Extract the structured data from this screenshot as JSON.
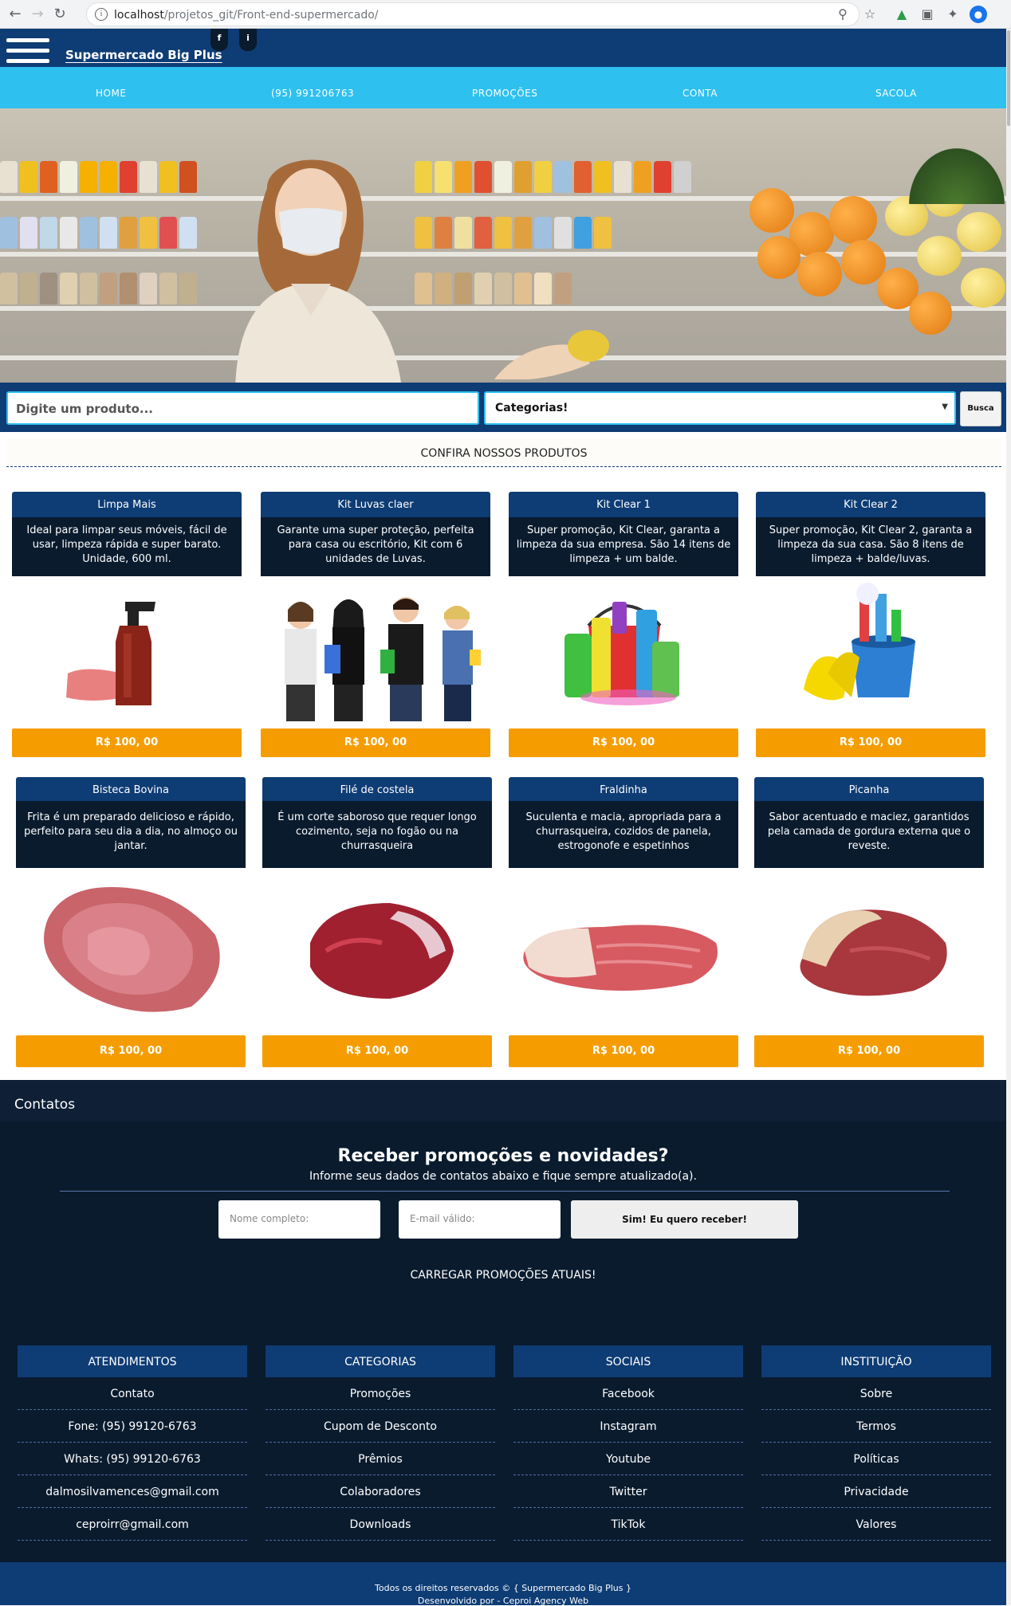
{
  "browser": {
    "url_host": "localhost",
    "url_path": "/projetos_git/Front-end-supermercado/"
  },
  "header": {
    "site_name": "Supermercado Big Plus",
    "social_f": "f",
    "social_i": "i"
  },
  "nav": {
    "items": [
      "HOME",
      "(95) 991206763",
      "PROMOÇÕES",
      "CONTA",
      "SACOLA"
    ]
  },
  "search": {
    "placeholder": "Digite um produto...",
    "category_selected": "Categorias!",
    "button_label": "Busca"
  },
  "products_section": {
    "title": "CONFIRA NOSSOS PRODUTOS"
  },
  "products": [
    {
      "name": "Limpa Mais",
      "description": "Ideal para limpar seus móveis, fácil de usar, limpeza rápida e super barato. Unidade, 600 ml.",
      "price": "R$ 100, 00",
      "image_icon": "spray-bottle-icon"
    },
    {
      "name": "Kit Luvas claer",
      "description": "Garante uma super proteção, perfeita para casa ou escritório, Kit com 6 unidades de Luvas.",
      "price": "R$ 100, 00",
      "image_icon": "cleaning-team-icon"
    },
    {
      "name": "Kit Clear 1",
      "description": "Super promoção, Kit Clear, garanta a limpeza da sua empresa. São 14 itens de limpeza + um balde.",
      "price": "R$ 100, 00",
      "image_icon": "cleaning-bucket-icon"
    },
    {
      "name": "Kit Clear 2",
      "description": "Super promoção, Kit Clear 2, garanta a limpeza da sua casa. São 8 itens de limpeza + balde/luvas.",
      "price": "R$ 100, 00",
      "image_icon": "bucket-gloves-icon"
    },
    {
      "name": "Bisteca Bovina",
      "description": "Frita é um preparado delicioso e rápido, perfeito para seu dia a dia, no almoço ou jantar.",
      "price": "R$ 100, 00",
      "image_icon": "steak-icon"
    },
    {
      "name": "Filé de costela",
      "description": "É um corte saboroso que requer longo cozimento, seja no fogão ou na churrasqueira",
      "price": "R$ 100, 00",
      "image_icon": "rib-meat-icon"
    },
    {
      "name": "Fraldinha",
      "description": "Suculenta e macia, apropriada para a churrasqueira, cozidos de panela, estrogonofe e espetinhos",
      "price": "R$ 100, 00",
      "image_icon": "flank-meat-icon"
    },
    {
      "name": "Picanha",
      "description": "Sabor acentuado e maciez, garantidos pela camada de gordura externa que o reveste.",
      "price": "R$ 100, 00",
      "image_icon": "picanha-icon"
    }
  ],
  "contacts": {
    "title": "Contatos",
    "promo_title": "Receber promoções e novidades?",
    "promo_sub": "Informe seus dados de contatos abaixo e fique sempre atualizado(a).",
    "name_placeholder": "Nome completo:",
    "email_placeholder": "E-mail válido:",
    "subscribe_label": "Sim! Eu quero receber!",
    "load_promos": "CARREGAR PROMOÇÕES ATUAIS!"
  },
  "footer_columns": [
    {
      "title": "ATENDIMENTOS",
      "items": [
        "Contato",
        "Fone: (95) 99120-6763",
        "Whats: (95) 99120-6763",
        "dalmosilvamences@gmail.com",
        "ceproirr@gmail.com"
      ]
    },
    {
      "title": "CATEGORIAS",
      "items": [
        "Promoções",
        "Cupom de Desconto",
        "Prêmios",
        "Colaboradores",
        "Downloads"
      ]
    },
    {
      "title": "SOCIAIS",
      "items": [
        "Facebook",
        "Instagram",
        "Youtube",
        "Twitter",
        "TikTok"
      ]
    },
    {
      "title": "INSTITUIÇÃO",
      "items": [
        "Sobre",
        "Termos",
        "Políticas",
        "Privacidade",
        "Valores"
      ]
    }
  ],
  "footer": {
    "copyright": "Todos os direitos reservados © { Supermercado Big Plus }",
    "developed_by": "Desenvolvido por - Ceproi Agency Web"
  },
  "colors": {
    "navy": "#0e3c74",
    "dark": "#0a1b2e",
    "cyan": "#2ec0ef",
    "orange": "#f59d00"
  }
}
